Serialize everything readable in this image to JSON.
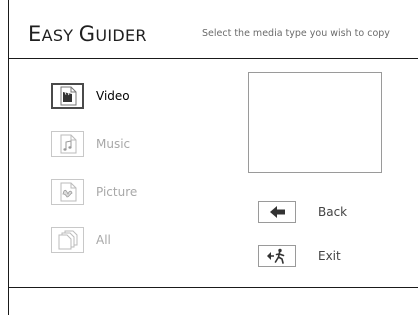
{
  "header": {
    "title_first": "E",
    "title_rest1": "ASY ",
    "title_second": "G",
    "title_rest2": "UIDER",
    "subtitle": "Select the media type you wish to copy"
  },
  "media_types": [
    {
      "label": "Video",
      "icon": "video-clapper-icon",
      "selected": true
    },
    {
      "label": "Music",
      "icon": "music-note-icon",
      "selected": false
    },
    {
      "label": "Picture",
      "icon": "picture-icon",
      "selected": false
    },
    {
      "label": "All",
      "icon": "all-media-icon",
      "selected": false
    }
  ],
  "actions": [
    {
      "label": "Back",
      "icon": "back-arrow-icon"
    },
    {
      "label": "Exit",
      "icon": "exit-icon"
    }
  ],
  "colors": {
    "border": "#1a1a1a",
    "selected_text": "#000000",
    "dim_text": "#a8a8a8",
    "subtitle": "#6b6b6b"
  }
}
